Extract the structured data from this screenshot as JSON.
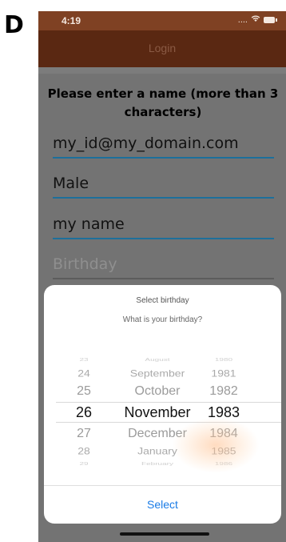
{
  "panel_label": "D",
  "status_bar": {
    "time": "4:19",
    "signal": "...."
  },
  "nav": {
    "title": "Login"
  },
  "form": {
    "prompt": "Please enter a name (more than 3 characters)",
    "email_value": "my_id@my_domain.com",
    "gender_value": "Male",
    "name_value": "my name",
    "birthday_placeholder": "Birthday"
  },
  "picker_sheet": {
    "title": "Select birthday",
    "subtitle": "What is your birthday?",
    "days": [
      "23",
      "24",
      "25",
      "26",
      "27",
      "28",
      "29"
    ],
    "months": [
      "August",
      "September",
      "October",
      "November",
      "December",
      "January",
      "February"
    ],
    "years": [
      "1980",
      "1981",
      "1982",
      "1983",
      "1984",
      "1985",
      "1986"
    ],
    "selected": {
      "day": "26",
      "month": "November",
      "year": "1983"
    },
    "select_label": "Select",
    "accent_color": "#1a7be6"
  }
}
